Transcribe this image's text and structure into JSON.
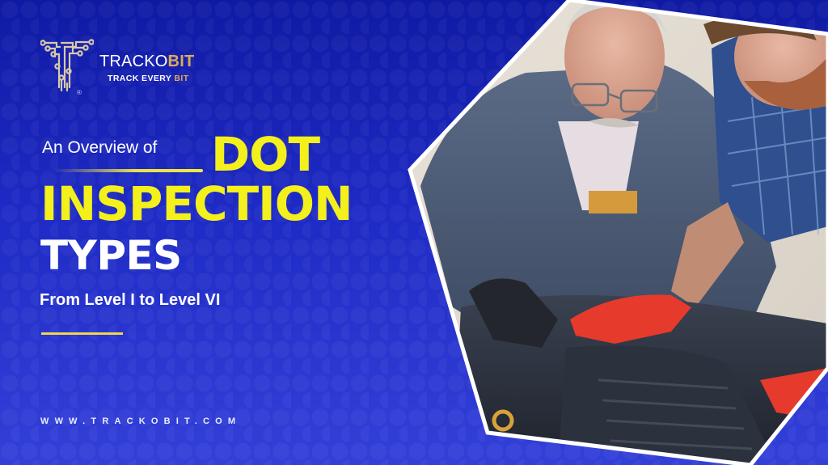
{
  "brand": {
    "name_main": "TRACKO",
    "name_accent": "BIT",
    "tagline_main": "TRACK EVERY ",
    "tagline_accent": "BIT",
    "registered_mark": "®",
    "logo_icon": "circuit-t-logo-icon"
  },
  "headline": {
    "intro": "An Overview of",
    "line1": "DOT",
    "line2": "INSPECTION",
    "line3": "TYPES",
    "subtitle": "From Level I to Level VI"
  },
  "footer": {
    "website": "WWW.TRACKOBIT.COM"
  },
  "photo": {
    "description": "Two mechanics inspecting a car engine under an open hood, framed in a white-bordered hexagonal cutout",
    "subjects": [
      "older mechanic in grey uniform with glasses and black gloves",
      "bearded man in blue plaid shirt with red gloves"
    ]
  },
  "colors": {
    "background_top": "#0f1aa3",
    "background_bottom": "#3340d8",
    "headline_yellow": "#f3f01c",
    "brand_gold": "#d9ab5b",
    "accent_line": "#f0d54a",
    "text_white": "#ffffff"
  }
}
